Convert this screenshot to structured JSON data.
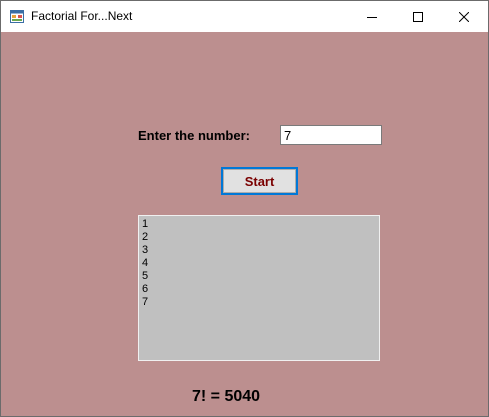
{
  "window": {
    "title": "Factorial For...Next",
    "icon": "app-form-icon",
    "controls": {
      "minimize": "minimize-icon",
      "maximize": "maximize-icon",
      "close": "close-icon"
    }
  },
  "form": {
    "prompt_label": "Enter the number:",
    "number_value": "7",
    "start_label": "Start",
    "list_items": [
      "1",
      "2",
      "3",
      "4",
      "5",
      "6",
      "7"
    ],
    "result_text": "7! = 5040"
  },
  "colors": {
    "form_background": "#bc8f8f",
    "listbox_background": "#c0c0c0",
    "button_text": "#7a0000",
    "focus_border": "#0078d7"
  }
}
